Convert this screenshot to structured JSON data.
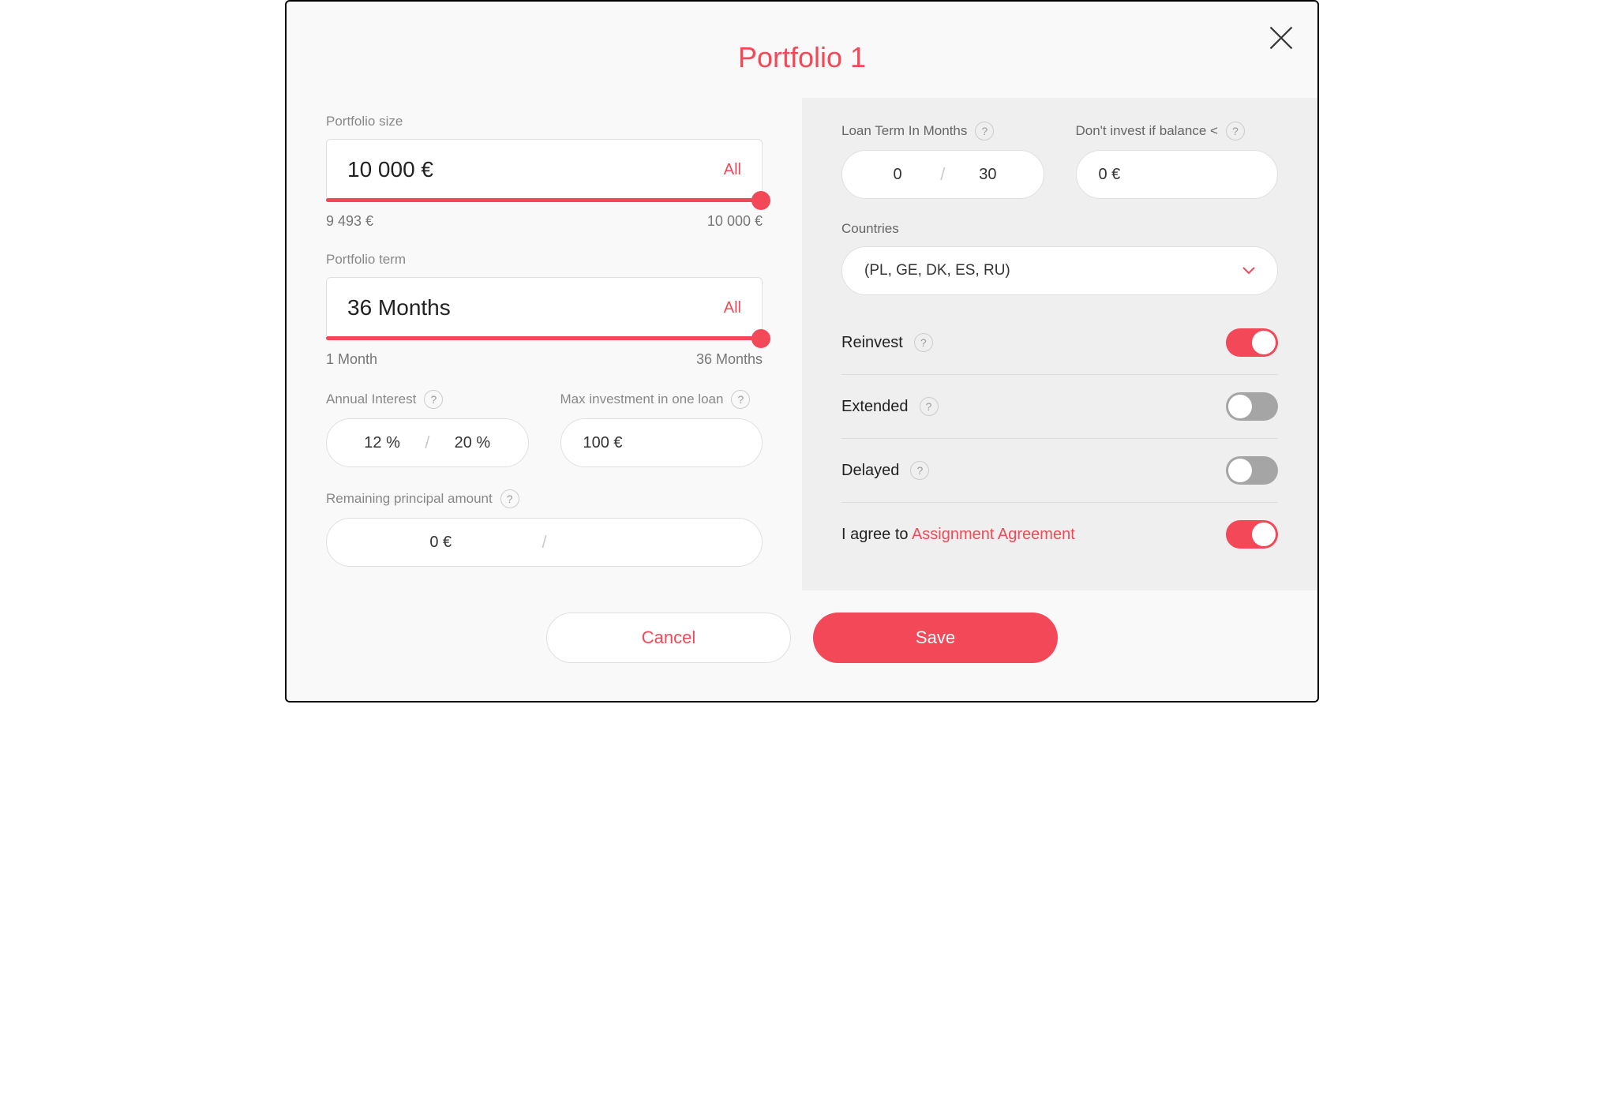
{
  "title": "Portfolio 1",
  "portfolio_size": {
    "label": "Portfolio size",
    "value": "10 000 €",
    "all": "All",
    "min": "9 493 €",
    "max": "10 000 €"
  },
  "portfolio_term": {
    "label": "Portfolio term",
    "value": "36 Months",
    "all": "All",
    "min": "1 Month",
    "max": "36 Months"
  },
  "annual_interest": {
    "label": "Annual Interest",
    "min": "12 %",
    "max": "20 %"
  },
  "max_investment": {
    "label": "Max investment in one loan",
    "value": "100 €"
  },
  "remaining_principal": {
    "label": "Remaining principal amount",
    "min_placeholder": "0 €",
    "max_placeholder": ""
  },
  "loan_term": {
    "label": "Loan Term In Months",
    "min": "0",
    "max": "30"
  },
  "dont_invest": {
    "label": "Don't invest if balance <",
    "value": "0 €"
  },
  "countries": {
    "label": "Countries",
    "value": "(PL, GE, DK, ES, RU)"
  },
  "toggles": {
    "reinvest": {
      "label": "Reinvest",
      "on": true
    },
    "extended": {
      "label": "Extended",
      "on": false
    },
    "delayed": {
      "label": "Delayed",
      "on": false
    }
  },
  "agreement": {
    "prefix": "I agree to ",
    "link": "Assignment Agreement",
    "on": true
  },
  "buttons": {
    "cancel": "Cancel",
    "save": "Save"
  },
  "help_glyph": "?"
}
